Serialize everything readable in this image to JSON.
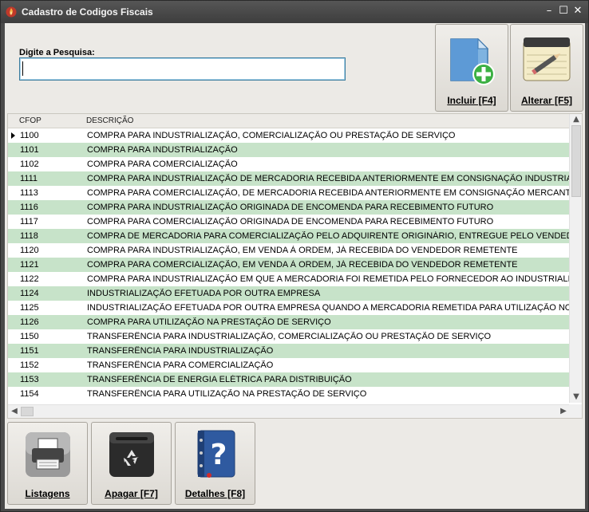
{
  "window": {
    "title": "Cadastro de Codigos Fiscais",
    "controls": {
      "minimize": "–",
      "maximize": "☐",
      "close": "✕"
    }
  },
  "search": {
    "label": "Digite a Pesquisa:",
    "value": "",
    "placeholder": ""
  },
  "toolbar": {
    "incluir": "Incluir [F4]",
    "alterar": "Alterar [F5]",
    "listagens": "Listagens",
    "apagar": "Apagar [F7]",
    "detalhes": "Detalhes [F8]"
  },
  "grid": {
    "columns": [
      "CFOP",
      "DESCRIÇÃO"
    ],
    "selected_row": 0,
    "rows": [
      {
        "cfop": "1100",
        "descricao": "COMPRA PARA INDUSTRIALIZAÇÃO, COMERCIALIZAÇÃO OU PRESTAÇÃO DE SERVIÇO"
      },
      {
        "cfop": "1101",
        "descricao": "COMPRA PARA INDUSTRIALIZAÇÃO"
      },
      {
        "cfop": "1102",
        "descricao": "COMPRA PARA COMERCIALIZAÇÃO"
      },
      {
        "cfop": "1111",
        "descricao": "COMPRA PARA INDUSTRIALIZAÇÃO DE MERCADORIA RECEBIDA ANTERIORMENTE EM CONSIGNAÇÃO INDUSTRIAL"
      },
      {
        "cfop": "1113",
        "descricao": "COMPRA PARA COMERCIALIZAÇÃO, DE MERCADORIA RECEBIDA ANTERIORMENTE EM CONSIGNAÇÃO MERCANTIL"
      },
      {
        "cfop": "1116",
        "descricao": "COMPRA PARA INDUSTRIALIZAÇÃO ORIGINADA DE ENCOMENDA PARA RECEBIMENTO FUTURO"
      },
      {
        "cfop": "1117",
        "descricao": "COMPRA PARA COMERCIALIZAÇÃO ORIGINADA DE ENCOMENDA PARA RECEBIMENTO FUTURO"
      },
      {
        "cfop": "1118",
        "descricao": "COMPRA DE MERCADORIA PARA COMERCIALIZAÇÃO PELO ADQUIRENTE ORIGINÁRIO, ENTREGUE PELO VENDEDOR REI"
      },
      {
        "cfop": "1120",
        "descricao": "COMPRA PARA INDUSTRIALIZAÇÃO, EM VENDA À ORDEM, JÁ RECEBIDA DO VENDEDOR REMETENTE"
      },
      {
        "cfop": "1121",
        "descricao": "COMPRA PARA COMERCIALIZAÇÃO, EM VENDA À ORDEM, JÁ RECEBIDA DO VENDEDOR REMETENTE"
      },
      {
        "cfop": "1122",
        "descricao": "COMPRA PARA INDUSTRIALIZAÇÃO EM QUE A MERCADORIA FOI REMETIDA PELO FORNECEDOR AO INDUSTRIALIZADOR"
      },
      {
        "cfop": "1124",
        "descricao": "INDUSTRIALIZAÇÃO EFETUADA POR OUTRA EMPRESA"
      },
      {
        "cfop": "1125",
        "descricao": "INDUSTRIALIZAÇÃO EFETUADA POR OUTRA EMPRESA QUANDO A MERCADORIA REMETIDA PARA UTILIZAÇÃO NO PROC"
      },
      {
        "cfop": "1126",
        "descricao": "COMPRA PARA UTILIZAÇÃO NA PRESTAÇÃO DE SERVIÇO"
      },
      {
        "cfop": "1150",
        "descricao": "TRANSFERÊNCIA PARA INDUSTRIALIZAÇÃO, COMERCIALIZAÇÃO OU PRESTAÇÃO DE SERVIÇO"
      },
      {
        "cfop": "1151",
        "descricao": "TRANSFERÊNCIA PARA INDUSTRIALIZAÇÃO"
      },
      {
        "cfop": "1152",
        "descricao": "TRANSFERÊNCIA PARA COMERCIALIZAÇÃO"
      },
      {
        "cfop": "1153",
        "descricao": "TRANSFERÊNCIA DE ENERGIA ELÉTRICA PARA DISTRIBUIÇÃO"
      },
      {
        "cfop": "1154",
        "descricao": "TRANSFERÊNCIA PARA UTILIZAÇÃO NA PRESTAÇÃO DE SERVIÇO"
      }
    ]
  },
  "colors": {
    "alt_row": "#c7e3c9",
    "title_bar": "#4a4a4a",
    "accent_plus": "#3cb043"
  },
  "icons": {
    "title": "flame-icon",
    "incluir": "document-add-icon",
    "alterar": "notepad-pencil-icon",
    "listagens": "printer-icon",
    "apagar": "recycle-bin-icon",
    "detalhes": "help-book-icon"
  }
}
